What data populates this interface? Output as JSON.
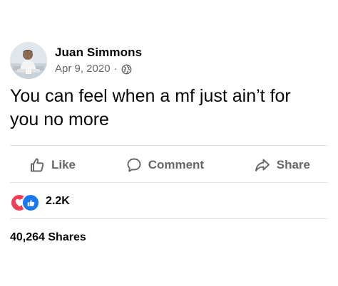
{
  "post": {
    "author": "Juan Simmons",
    "date": "Apr 9, 2020",
    "separator": "·",
    "text": "You can feel when a mf just ain’t for you no more",
    "privacy_icon": "globe-icon",
    "avatar_icon": "profile-photo"
  },
  "actions": {
    "like_label": "Like",
    "comment_label": "Comment",
    "share_label": "Share"
  },
  "reactions": {
    "types": [
      "love-reaction-icon",
      "like-reaction-icon"
    ],
    "count": "2.2K"
  },
  "shares": {
    "label": "40,264 Shares"
  },
  "colors": {
    "text": "#050505",
    "secondary": "#65676b",
    "divider": "#e4e6eb",
    "love": "#f33e58",
    "like": "#1877f2"
  }
}
